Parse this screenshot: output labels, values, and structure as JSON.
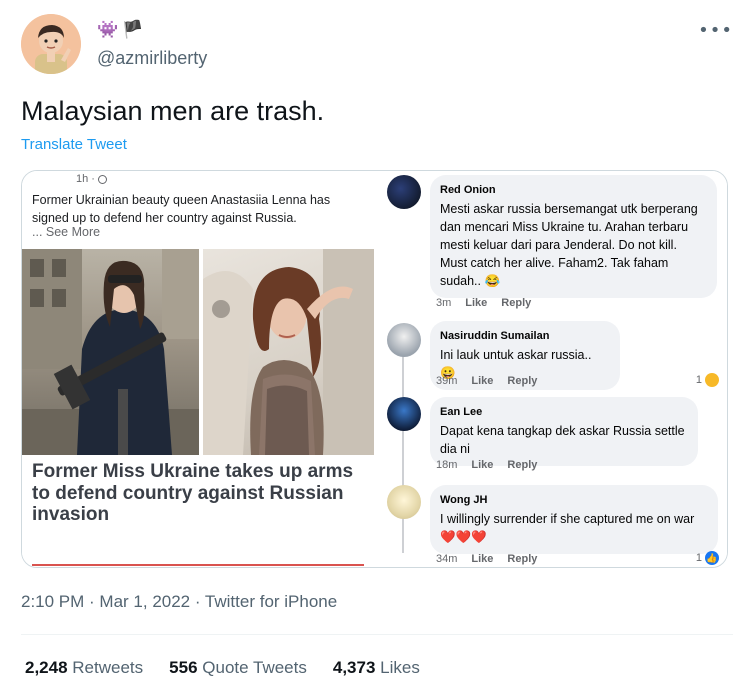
{
  "author": {
    "handle": "@azmirliberty",
    "name_emoji_icons": [
      "alien-monster-icon",
      "black-flag-icon"
    ]
  },
  "more_icon": "more-horizontal-icon",
  "tweet": {
    "text": "Malaysian men are trash.",
    "translate_label": "Translate Tweet"
  },
  "fb_post": {
    "time": "1h · ",
    "caption": "Former Ukrainian beauty queen Anastasiia Lenna has signed up to defend her country against Russia.",
    "see_more": "... See More",
    "headline": "Former Miss Ukraine takes up arms to defend country against Russian invasion"
  },
  "comments": [
    {
      "name": "Red Onion",
      "text": "Mesti askar russia bersemangat utk berperang dan mencari Miss Ukraine tu. Arahan terbaru mesti keluar dari para Jenderal. Do not kill. Must catch her alive. Faham2. Tak faham sudah..",
      "emoji": "😂",
      "time": "3m",
      "like": "Like",
      "reply": "Reply",
      "reaction_count": ""
    },
    {
      "name": "Nasiruddin Sumailan",
      "text": "Ini lauk untuk askar russia..",
      "emoji": "😀",
      "time": "39m",
      "like": "Like",
      "reply": "Reply",
      "reaction_count": "1"
    },
    {
      "name": "Ean Lee",
      "text": "Dapat kena tangkap dek askar Russia settle dia ni",
      "emoji": "",
      "time": "18m",
      "like": "Like",
      "reply": "Reply",
      "reaction_count": ""
    },
    {
      "name": "Wong JH",
      "text": "I willingly surrender if she captured me on war",
      "emoji": "❤️❤️❤️",
      "time": "34m",
      "like": "Like",
      "reply": "Reply",
      "reaction_count": "1"
    }
  ],
  "footer": {
    "timestamp": "2:10 PM · Mar 1, 2022 · Twitter for iPhone",
    "retweets_count": "2,248",
    "retweets_label": "Retweets",
    "quotes_count": "556",
    "quotes_label": "Quote Tweets",
    "likes_count": "4,373",
    "likes_label": "Likes"
  },
  "colors": {
    "link_blue": "#1d9bf0",
    "secondary_text": "#536471",
    "fb_bubble": "#f0f2f5",
    "fb_red_rule": "#d9534f"
  }
}
